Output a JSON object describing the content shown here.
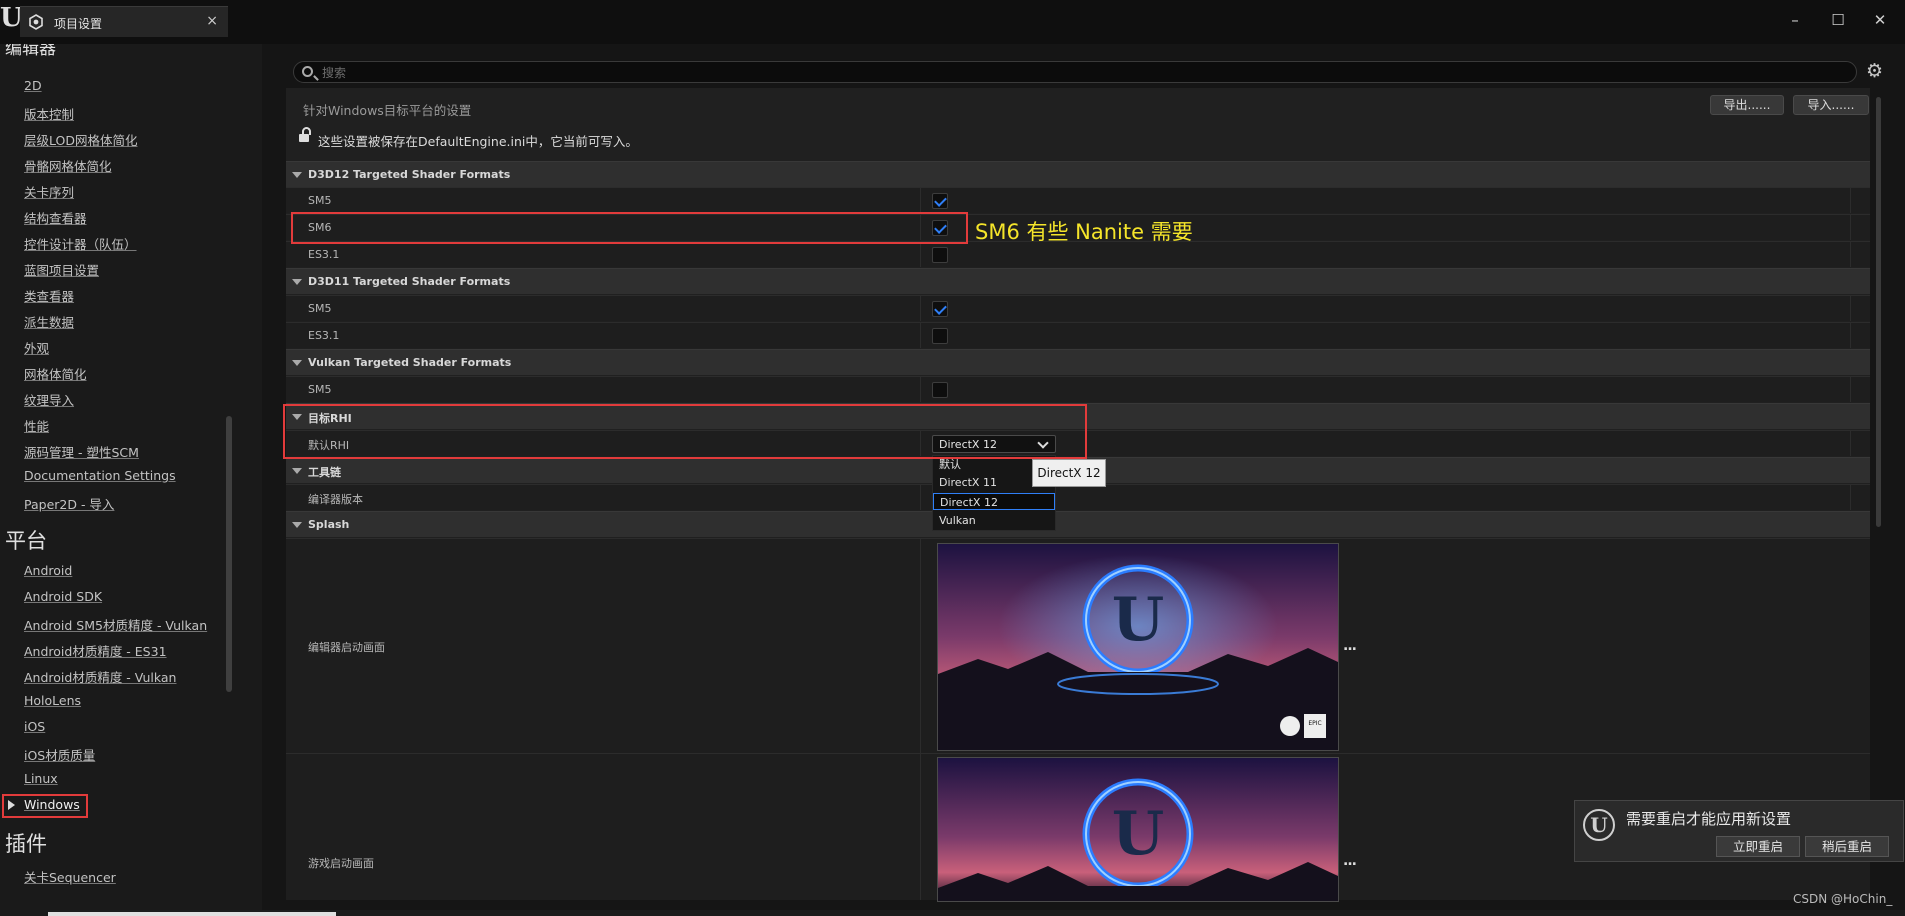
{
  "window": {
    "app_logo": "U",
    "tab_title": "项目设置",
    "tab_icon": "settings-icon",
    "close": "×",
    "minimize": "–",
    "maximize": "☐",
    "window_close": "✕"
  },
  "sidebar": {
    "top_partial_heading": "编辑器",
    "editor_items": [
      "2D",
      "版本控制",
      "层级LOD网格体简化",
      "骨骼网格体简化",
      "关卡序列",
      "结构查看器",
      "控件设计器（队伍）",
      "蓝图项目设置",
      "类查看器",
      "派生数据",
      "外观",
      "网格体简化",
      "纹理导入",
      "性能",
      "源码管理 - 塑性SCM",
      "Documentation Settings",
      "Paper2D - 导入"
    ],
    "platform_heading": "平台",
    "platform_items": [
      "Android",
      "Android SDK",
      "Android SM5材质精度 - Vulkan",
      "Android材质精度 - ES31",
      "Android材质精度 - Vulkan",
      "HoloLens",
      "iOS",
      "iOS材质质量",
      "Linux",
      "Windows"
    ],
    "selected_item": "Windows",
    "plugins_heading": "插件",
    "plugin_items": [
      "关卡Sequencer"
    ]
  },
  "search": {
    "placeholder": "搜索",
    "value": ""
  },
  "header": {
    "subtitle": "针对Windows目标平台的设置",
    "export_label": "导出......",
    "import_label": "导入......",
    "notice": "这些设置被保存在DefaultEngine.ini中，它当前可写入。"
  },
  "sections": {
    "d3d12": {
      "title": "D3D12 Targeted Shader Formats",
      "rows": [
        {
          "label": "SM5",
          "checked": true
        },
        {
          "label": "SM6",
          "checked": true
        },
        {
          "label": "ES3.1",
          "checked": false
        }
      ]
    },
    "d3d11": {
      "title": "D3D11 Targeted Shader Formats",
      "rows": [
        {
          "label": "SM5",
          "checked": true
        },
        {
          "label": "ES3.1",
          "checked": false
        }
      ]
    },
    "vulkan": {
      "title": "Vulkan Targeted Shader Formats",
      "rows": [
        {
          "label": "SM5",
          "checked": false
        }
      ]
    },
    "target_rhi": {
      "title": "目标RHI",
      "default_rhi_label": "默认RHI",
      "selected": "DirectX 12",
      "options": [
        "默认",
        "DirectX 11",
        "DirectX 12",
        "Vulkan"
      ],
      "tooltip": "DirectX 12"
    },
    "toolchain": {
      "title": "工具链",
      "compiler_label": "编译器版本"
    },
    "splash": {
      "title": "Splash",
      "editor_splash_label": "编辑器启动画面",
      "game_splash_label": "游戏启动画面",
      "logo_text": "EPIC GAMES",
      "browse_label": "..."
    }
  },
  "annotation": {
    "text": "SM6 有些 Nanite 需要",
    "color": "#f5e52a",
    "box_color": "#e23b3b"
  },
  "toast": {
    "message": "需要重启才能应用新设置",
    "restart_now": "立即重启",
    "restart_later": "稍后重启"
  },
  "watermark": "CSDN @HoChin_",
  "colors": {
    "accent": "#2f7ff7",
    "background": "#151515",
    "panel": "#202020"
  }
}
